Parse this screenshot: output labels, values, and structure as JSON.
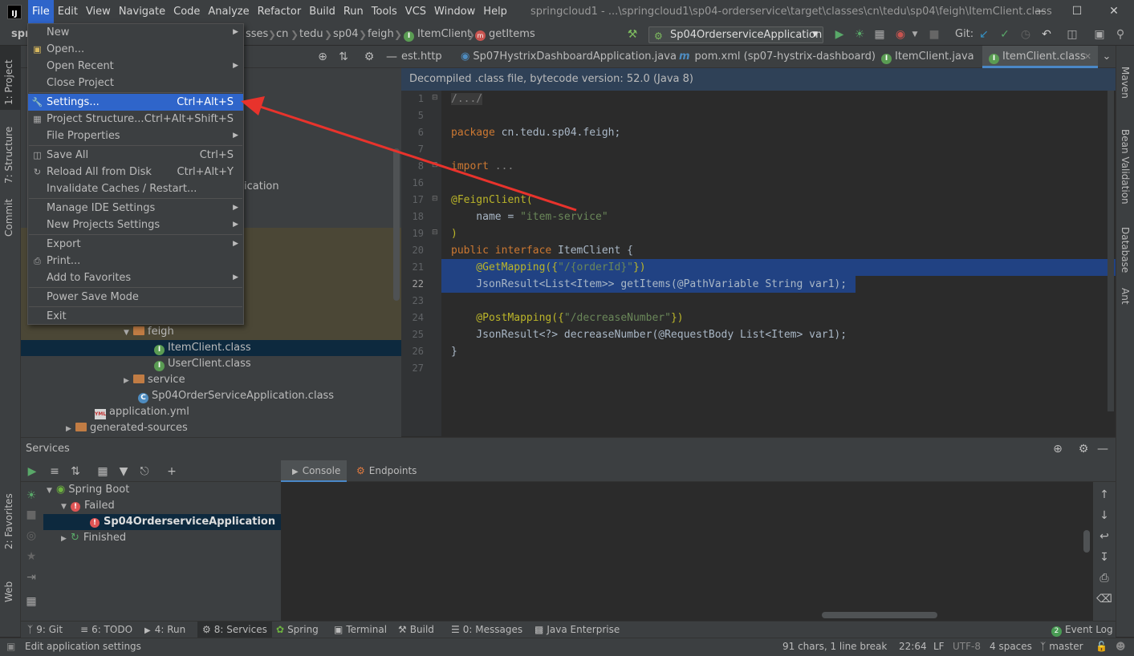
{
  "titlebar": {
    "logo": "IJ",
    "menus": [
      "File",
      "Edit",
      "View",
      "Navigate",
      "Code",
      "Analyze",
      "Refactor",
      "Build",
      "Run",
      "Tools",
      "VCS",
      "Window",
      "Help"
    ],
    "window_title": "springcloud1 - ...\\springcloud1\\sp04-orderservice\\target\\classes\\cn\\tedu\\sp04\\feigh\\ItemClient.class"
  },
  "navbar": {
    "crumbs": [
      "spr",
      "sses",
      "cn",
      "tedu",
      "sp04",
      "feigh",
      "ItemClient",
      "getItems"
    ],
    "run_config": "Sp04OrderserviceApplication",
    "git_label": "Git:"
  },
  "file_menu": {
    "items": [
      {
        "label": "New",
        "shortcut": "",
        "submenu": true,
        "icon": ""
      },
      {
        "label": "Open...",
        "shortcut": "",
        "submenu": false,
        "icon": "folder-icon"
      },
      {
        "label": "Open Recent",
        "shortcut": "",
        "submenu": true,
        "icon": ""
      },
      {
        "label": "Close Project",
        "shortcut": "",
        "submenu": false,
        "icon": ""
      },
      {
        "label": "Settings...",
        "shortcut": "Ctrl+Alt+S",
        "submenu": false,
        "icon": "wrench-icon"
      },
      {
        "label": "Project Structure...",
        "shortcut": "Ctrl+Alt+Shift+S",
        "submenu": false,
        "icon": "project-structure-icon"
      },
      {
        "label": "File Properties",
        "shortcut": "",
        "submenu": true,
        "icon": ""
      },
      {
        "label": "Save All",
        "shortcut": "Ctrl+S",
        "submenu": false,
        "icon": "save-icon"
      },
      {
        "label": "Reload All from Disk",
        "shortcut": "Ctrl+Alt+Y",
        "submenu": false,
        "icon": "reload-icon"
      },
      {
        "label": "Invalidate Caches / Restart...",
        "shortcut": "",
        "submenu": false,
        "icon": ""
      },
      {
        "label": "Manage IDE Settings",
        "shortcut": "",
        "submenu": true,
        "icon": ""
      },
      {
        "label": "New Projects Settings",
        "shortcut": "",
        "submenu": true,
        "icon": ""
      },
      {
        "label": "Export",
        "shortcut": "",
        "submenu": true,
        "icon": ""
      },
      {
        "label": "Print...",
        "shortcut": "",
        "submenu": false,
        "icon": "print-icon"
      },
      {
        "label": "Add to Favorites",
        "shortcut": "",
        "submenu": true,
        "icon": ""
      },
      {
        "label": "Power Save Mode",
        "shortcut": "",
        "submenu": false,
        "icon": ""
      },
      {
        "label": "Exit",
        "shortcut": "",
        "submenu": false,
        "icon": ""
      }
    ]
  },
  "project_tree": {
    "partial_text": "ication",
    "rows": [
      {
        "label": "feigh",
        "type": "folder"
      },
      {
        "label": "ItemClient.class",
        "type": "interface"
      },
      {
        "label": "UserClient.class",
        "type": "interface"
      },
      {
        "label": "service",
        "type": "folder"
      },
      {
        "label": "Sp04OrderServiceApplication.class",
        "type": "class"
      },
      {
        "label": "application.yml",
        "type": "yml"
      },
      {
        "label": "generated-sources",
        "type": "folder"
      }
    ]
  },
  "editor": {
    "tabs": [
      "est.http",
      "Sp07HystrixDashboardApplication.java",
      "pom.xml (sp07-hystrix-dashboard)",
      "ItemClient.java",
      "ItemClient.class"
    ],
    "banner": "Decompiled .class file, bytecode version: 52.0 (Java 8)",
    "line_numbers": [
      "1",
      "5",
      "6",
      "7",
      "8",
      "16",
      "17",
      "18",
      "19",
      "20",
      "21",
      "22",
      "23",
      "24",
      "25",
      "26",
      "27"
    ],
    "code": {
      "l1": "/.../",
      "l6_kw": "package",
      "l6_rest": " cn.tedu.sp04.feigh;",
      "l8_kw": "import",
      "l8_rest": " ...",
      "l17": "@FeignClient(",
      "l18_a": "    name = ",
      "l18_s": "\"item-service\"",
      "l19": ")",
      "l20_kw": "public interface",
      "l20_rest": " ItemClient {",
      "l21_a": "    @GetMapping({",
      "l21_s": "\"/{orderId}\"",
      "l21_b": "})",
      "l22": "    JsonResult<List<Item>> getItems(@PathVariable String var1);",
      "l24_a": "    @PostMapping({",
      "l24_s": "\"/decreaseNumber\"",
      "l24_b": "})",
      "l25": "    JsonResult<?> decreaseNumber(@RequestBody List<Item> var1);",
      "l26": "}"
    }
  },
  "services": {
    "title": "Services",
    "tree": [
      {
        "label": "Spring Boot"
      },
      {
        "label": "Failed"
      },
      {
        "label": "Sp04OrderserviceApplication"
      },
      {
        "label": "Finished"
      }
    ],
    "console_tabs": [
      "Console",
      "Endpoints"
    ]
  },
  "left_stripe": [
    "1: Project",
    "7: Structure",
    "Commit",
    "2: Favorites",
    "Web"
  ],
  "right_stripe": [
    "Maven",
    "Bean Validation",
    "Database",
    "Ant"
  ],
  "bottom_tools": [
    "9: Git",
    "6: TODO",
    "4: Run",
    "8: Services",
    "Spring",
    "Terminal",
    "Build",
    "0: Messages",
    "Java Enterprise",
    "Event Log"
  ],
  "event_log_count": "2",
  "status": {
    "message": "Edit application settings",
    "chars": "91 chars, 1 line break",
    "position": "22:64",
    "line_sep": "LF",
    "encoding": "UTF-8",
    "indent": "4 spaces",
    "branch": "master"
  },
  "colors": {
    "accent": "#2f65ca",
    "annotation_arrow": "#e8332c",
    "selection": "#214283"
  }
}
